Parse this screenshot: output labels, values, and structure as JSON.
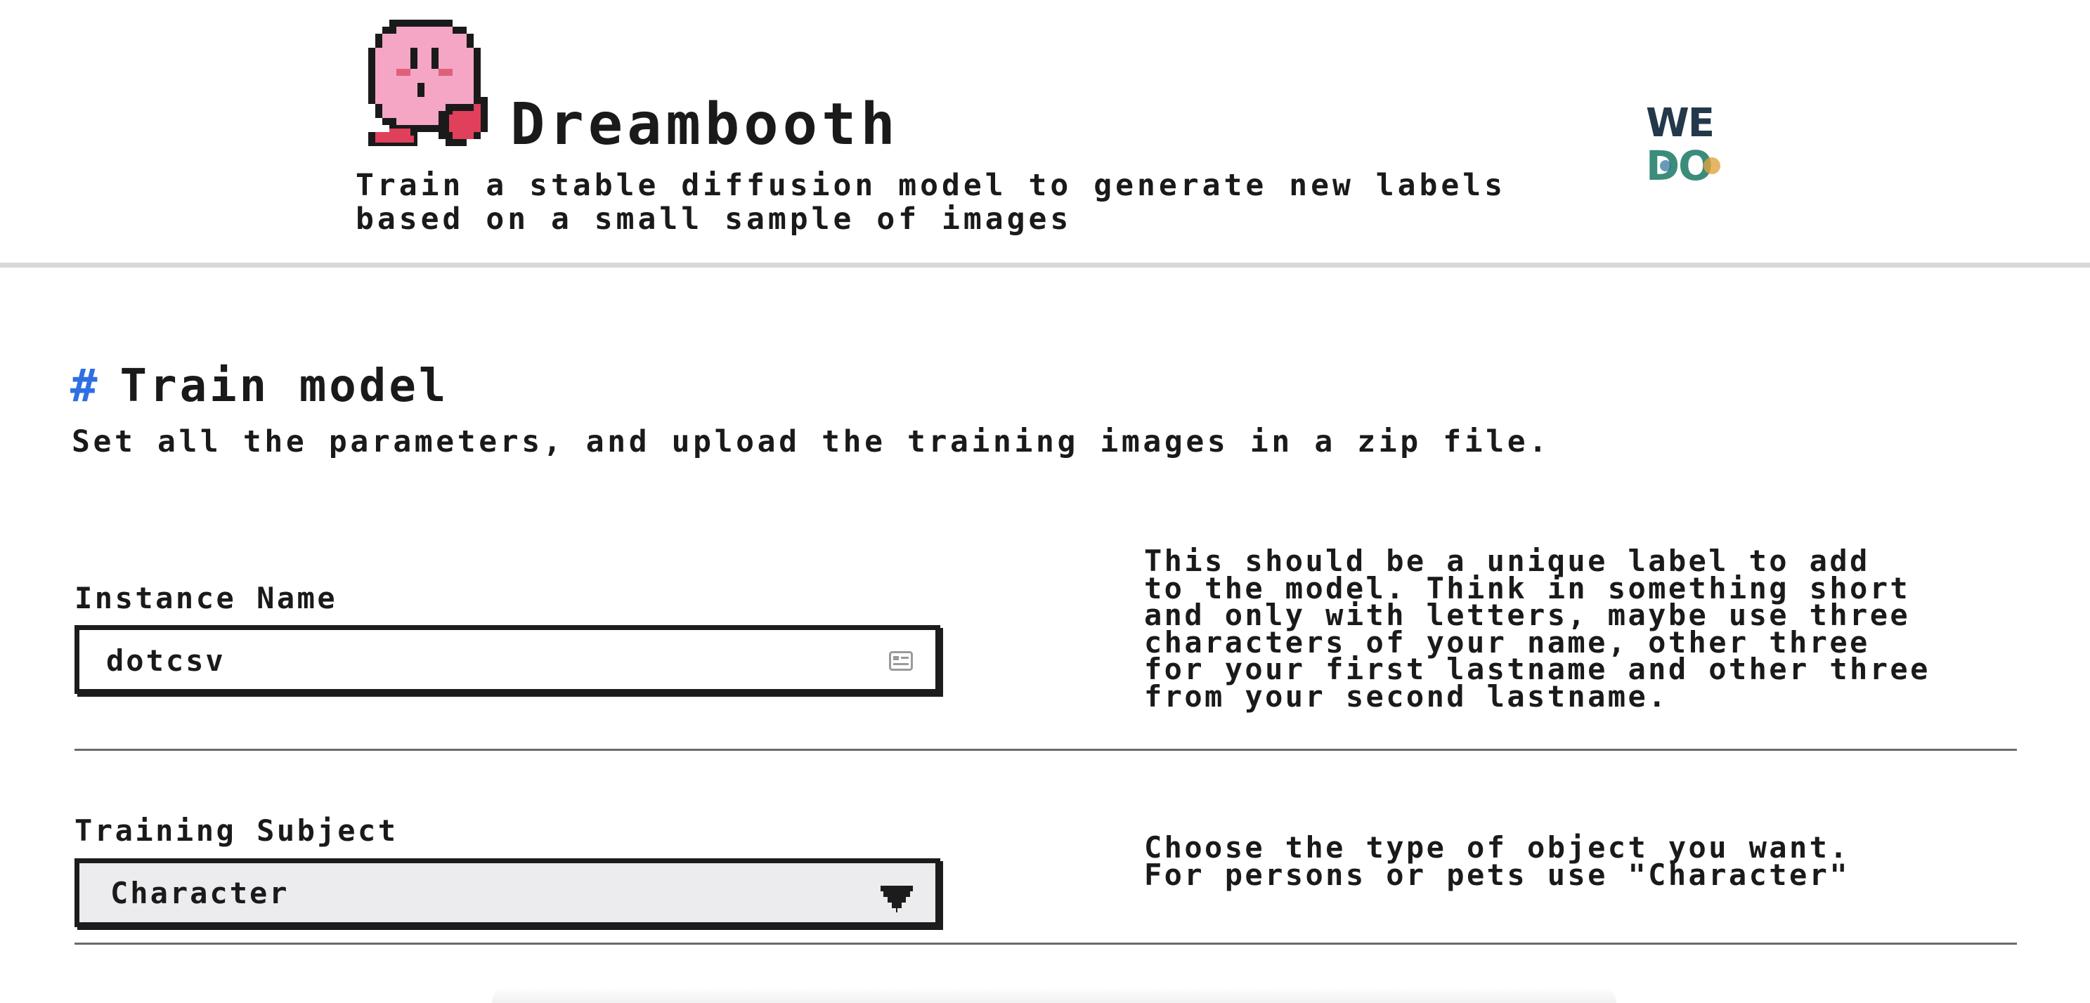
{
  "header": {
    "title": "Dreambooth",
    "subtitle": "Train a stable diffusion model to generate new labels based on a small sample of images",
    "logo_icon": "kirby-pixel-icon",
    "brand_icon": "wedo-logo-icon",
    "brand_text": "WEDO"
  },
  "section": {
    "hash": "#",
    "title": "Train model",
    "description": "Set all the parameters, and upload the training images in a zip file."
  },
  "instance_name": {
    "label": "Instance Name",
    "value": "dotcsv",
    "field_icon": "contact-card-icon",
    "help": "This should be a unique label to add\nto the model. Think in something short\nand only with letters, maybe use three\ncharacters of your name, other three\nfor your first lastname and other three\nfrom your second lastname."
  },
  "training_subject": {
    "label": "Training Subject",
    "selected": "Character",
    "arrow_icon": "dropdown-arrow-icon",
    "help": "Choose the type of object you want.\nFor persons or pets use \"Character\""
  },
  "colors": {
    "accent": "#2f6fe4",
    "text": "#1a1a1a",
    "select_bg": "#ececee",
    "kirby_pink": "#f4a6c4",
    "kirby_red": "#e0405a"
  }
}
